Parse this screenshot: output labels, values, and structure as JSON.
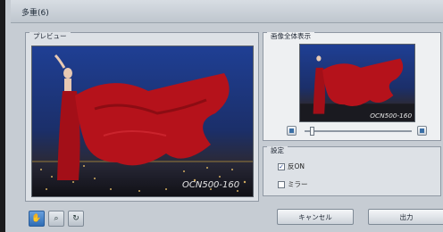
{
  "window": {
    "title": "多重(6)"
  },
  "preview": {
    "label": "プレビュー",
    "watermark": "OCN500-160"
  },
  "overview": {
    "label": "画像全体表示",
    "watermark": "OCN500-160"
  },
  "settings": {
    "label": "設定",
    "options": [
      {
        "label": "反ON",
        "checked": true
      },
      {
        "label": "ミラー",
        "checked": false
      }
    ]
  },
  "toolbar": {
    "tools": [
      "hand-tool",
      "zoom-tool",
      "rotate-tool"
    ]
  },
  "buttons": {
    "cancel": "キャンセル",
    "output": "出力"
  },
  "colors": {
    "dress_red": "#b5121b",
    "sky_blue": "#1c3e8c",
    "panel": "#dde1e6"
  }
}
